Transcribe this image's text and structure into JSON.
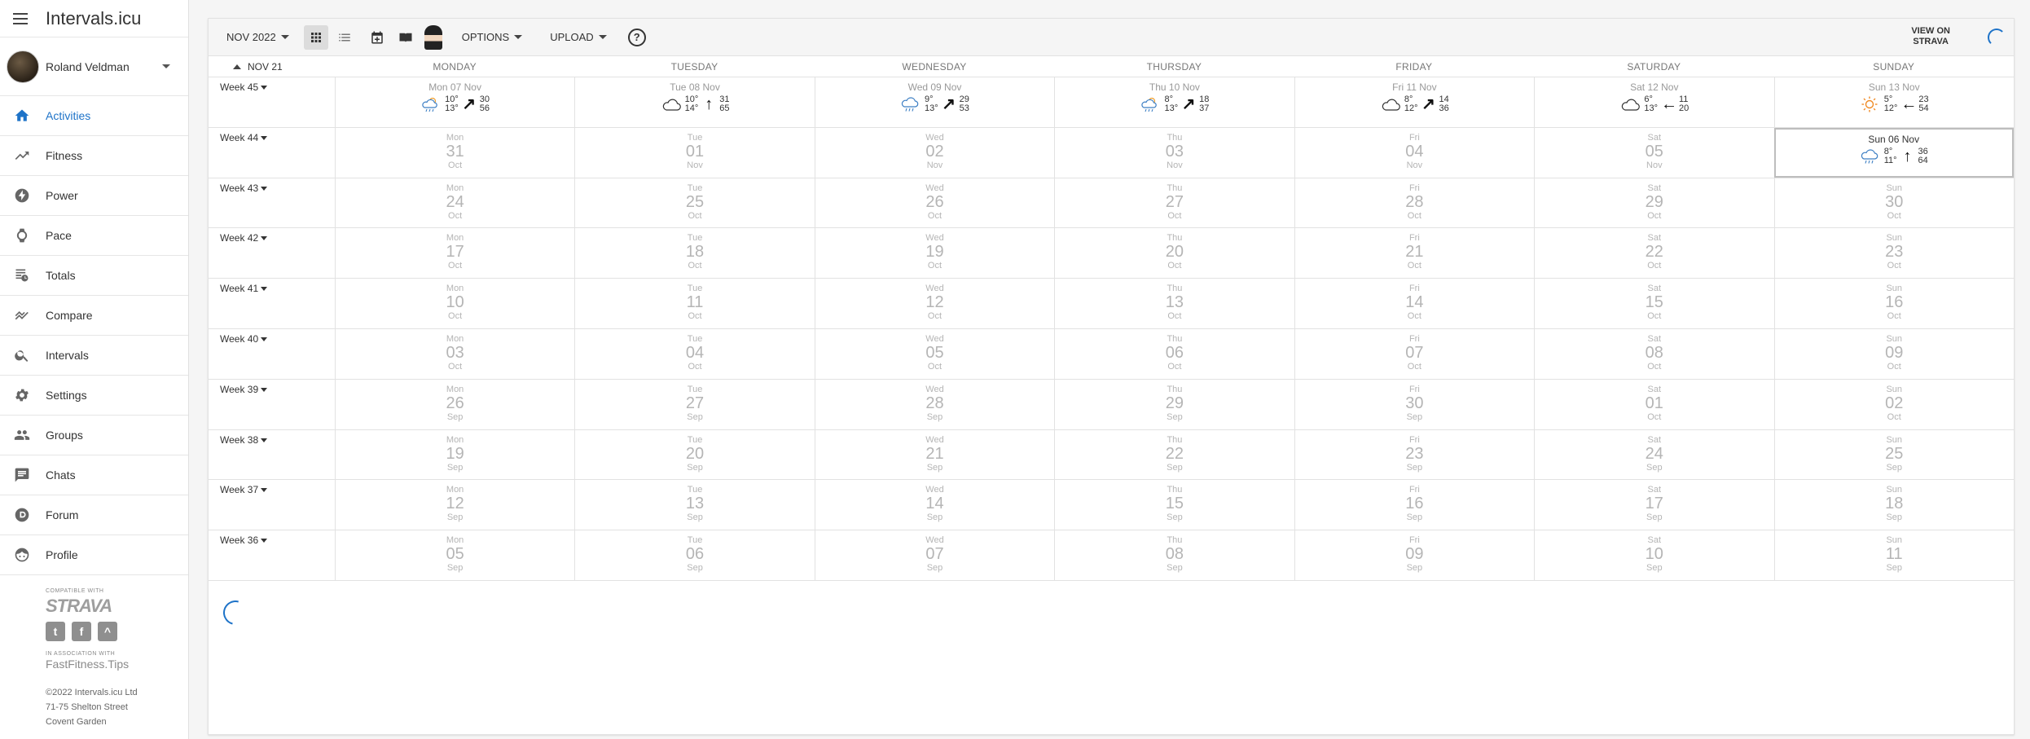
{
  "app": {
    "title": "Intervals.icu"
  },
  "user": {
    "name": "Roland Veldman"
  },
  "nav": [
    {
      "label": "Activities",
      "icon": "home-icon",
      "active": true
    },
    {
      "label": "Fitness",
      "icon": "trending-up-icon"
    },
    {
      "label": "Power",
      "icon": "power-bolt-icon"
    },
    {
      "label": "Pace",
      "icon": "watch-icon"
    },
    {
      "label": "Totals",
      "icon": "totals-table-icon"
    },
    {
      "label": "Compare",
      "icon": "compare-chart-icon"
    },
    {
      "label": "Intervals",
      "icon": "search-icon"
    },
    {
      "label": "Settings",
      "icon": "gear-icon"
    },
    {
      "label": "Groups",
      "icon": "groups-icon"
    },
    {
      "label": "Chats",
      "icon": "chat-icon"
    },
    {
      "label": "Forum",
      "icon": "forum-icon"
    },
    {
      "label": "Profile",
      "icon": "profile-face-icon"
    }
  ],
  "footer": {
    "compatible": "COMPATIBLE WITH",
    "strava": "STRAVA",
    "association": "IN ASSOCIATION WITH",
    "partner": "FastFitness.Tips",
    "copyright": "©2022 Intervals.icu Ltd",
    "address1": "71-75 Shelton Street",
    "address2": "Covent Garden"
  },
  "toolbar": {
    "month": "NOV 2022",
    "options": "OPTIONS",
    "upload": "UPLOAD",
    "help": "?",
    "view_on": "VIEW ON",
    "strava": "STRAVA"
  },
  "calendar": {
    "month_label": "NOV 21",
    "days": [
      "MONDAY",
      "TUESDAY",
      "WEDNESDAY",
      "THURSDAY",
      "FRIDAY",
      "SATURDAY",
      "SUNDAY"
    ],
    "forecast_week": {
      "label": "Week 45",
      "days": [
        {
          "label": "Mon 07 Nov",
          "icon": "partly-sunny-rain-icon",
          "hi": "10°",
          "lo": "13°",
          "arrow": "↗",
          "wind": "30",
          "gust": "56"
        },
        {
          "label": "Tue 08 Nov",
          "icon": "cloud-icon",
          "hi": "10°",
          "lo": "14°",
          "arrow": "↑",
          "wind": "31",
          "gust": "65"
        },
        {
          "label": "Wed 09 Nov",
          "icon": "rain-cloud-icon",
          "hi": "9°",
          "lo": "13°",
          "arrow": "↗",
          "wind": "29",
          "gust": "53"
        },
        {
          "label": "Thu 10 Nov",
          "icon": "partly-sunny-rain-icon",
          "hi": "8°",
          "lo": "13°",
          "arrow": "↗",
          "wind": "18",
          "gust": "37"
        },
        {
          "label": "Fri 11 Nov",
          "icon": "cloud-icon",
          "hi": "8°",
          "lo": "12°",
          "arrow": "↗",
          "wind": "14",
          "gust": "36"
        },
        {
          "label": "Sat 12 Nov",
          "icon": "cloud-icon",
          "hi": "6°",
          "lo": "13°",
          "arrow": "←",
          "wind": "11",
          "gust": "20"
        },
        {
          "label": "Sun 13 Nov",
          "icon": "sun-icon",
          "hi": "5°",
          "lo": "12°",
          "arrow": "←",
          "wind": "23",
          "gust": "54"
        }
      ]
    },
    "today": {
      "label": "Sun 06 Nov",
      "icon": "rain-cloud-icon",
      "hi": "8°",
      "lo": "11°",
      "arrow": "↑",
      "wind": "36",
      "gust": "64"
    },
    "weeks": [
      {
        "label": "Week 44",
        "days": [
          [
            "Mon",
            "31",
            "Oct"
          ],
          [
            "Tue",
            "01",
            "Nov"
          ],
          [
            "Wed",
            "02",
            "Nov"
          ],
          [
            "Thu",
            "03",
            "Nov"
          ],
          [
            "Fri",
            "04",
            "Nov"
          ],
          [
            "Sat",
            "05",
            "Nov"
          ],
          [
            "Sun",
            "06",
            "Nov"
          ]
        ]
      },
      {
        "label": "Week 43",
        "days": [
          [
            "Mon",
            "24",
            "Oct"
          ],
          [
            "Tue",
            "25",
            "Oct"
          ],
          [
            "Wed",
            "26",
            "Oct"
          ],
          [
            "Thu",
            "27",
            "Oct"
          ],
          [
            "Fri",
            "28",
            "Oct"
          ],
          [
            "Sat",
            "29",
            "Oct"
          ],
          [
            "Sun",
            "30",
            "Oct"
          ]
        ]
      },
      {
        "label": "Week 42",
        "days": [
          [
            "Mon",
            "17",
            "Oct"
          ],
          [
            "Tue",
            "18",
            "Oct"
          ],
          [
            "Wed",
            "19",
            "Oct"
          ],
          [
            "Thu",
            "20",
            "Oct"
          ],
          [
            "Fri",
            "21",
            "Oct"
          ],
          [
            "Sat",
            "22",
            "Oct"
          ],
          [
            "Sun",
            "23",
            "Oct"
          ]
        ]
      },
      {
        "label": "Week 41",
        "days": [
          [
            "Mon",
            "10",
            "Oct"
          ],
          [
            "Tue",
            "11",
            "Oct"
          ],
          [
            "Wed",
            "12",
            "Oct"
          ],
          [
            "Thu",
            "13",
            "Oct"
          ],
          [
            "Fri",
            "14",
            "Oct"
          ],
          [
            "Sat",
            "15",
            "Oct"
          ],
          [
            "Sun",
            "16",
            "Oct"
          ]
        ]
      },
      {
        "label": "Week 40",
        "days": [
          [
            "Mon",
            "03",
            "Oct"
          ],
          [
            "Tue",
            "04",
            "Oct"
          ],
          [
            "Wed",
            "05",
            "Oct"
          ],
          [
            "Thu",
            "06",
            "Oct"
          ],
          [
            "Fri",
            "07",
            "Oct"
          ],
          [
            "Sat",
            "08",
            "Oct"
          ],
          [
            "Sun",
            "09",
            "Oct"
          ]
        ]
      },
      {
        "label": "Week 39",
        "days": [
          [
            "Mon",
            "26",
            "Sep"
          ],
          [
            "Tue",
            "27",
            "Sep"
          ],
          [
            "Wed",
            "28",
            "Sep"
          ],
          [
            "Thu",
            "29",
            "Sep"
          ],
          [
            "Fri",
            "30",
            "Sep"
          ],
          [
            "Sat",
            "01",
            "Oct"
          ],
          [
            "Sun",
            "02",
            "Oct"
          ]
        ]
      },
      {
        "label": "Week 38",
        "days": [
          [
            "Mon",
            "19",
            "Sep"
          ],
          [
            "Tue",
            "20",
            "Sep"
          ],
          [
            "Wed",
            "21",
            "Sep"
          ],
          [
            "Thu",
            "22",
            "Sep"
          ],
          [
            "Fri",
            "23",
            "Sep"
          ],
          [
            "Sat",
            "24",
            "Sep"
          ],
          [
            "Sun",
            "25",
            "Sep"
          ]
        ]
      },
      {
        "label": "Week 37",
        "days": [
          [
            "Mon",
            "12",
            "Sep"
          ],
          [
            "Tue",
            "13",
            "Sep"
          ],
          [
            "Wed",
            "14",
            "Sep"
          ],
          [
            "Thu",
            "15",
            "Sep"
          ],
          [
            "Fri",
            "16",
            "Sep"
          ],
          [
            "Sat",
            "17",
            "Sep"
          ],
          [
            "Sun",
            "18",
            "Sep"
          ]
        ]
      },
      {
        "label": "Week 36",
        "days": [
          [
            "Mon",
            "05",
            "Sep"
          ],
          [
            "Tue",
            "06",
            "Sep"
          ],
          [
            "Wed",
            "07",
            "Sep"
          ],
          [
            "Thu",
            "08",
            "Sep"
          ],
          [
            "Fri",
            "09",
            "Sep"
          ],
          [
            "Sat",
            "10",
            "Sep"
          ],
          [
            "Sun",
            "11",
            "Sep"
          ]
        ]
      }
    ]
  }
}
